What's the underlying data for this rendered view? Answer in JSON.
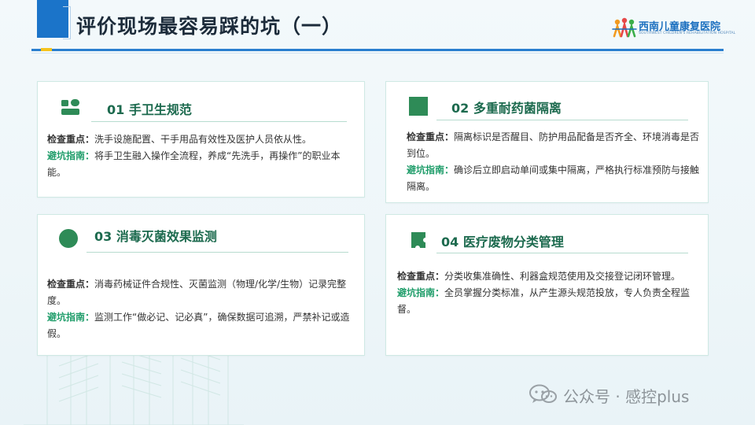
{
  "header": {
    "title": "评价现场最容易踩的坑（一）",
    "logo": {
      "name": "西南儿童康复医院",
      "subtitle": "SOUTHWEST CHILDREN'S REHABILITATION HOSPITAL"
    }
  },
  "labels": {
    "check": "检查重点：",
    "guide": "避坑指南："
  },
  "cards": [
    {
      "title": "01 手卫生规范",
      "icon": "hand-hygiene-icon",
      "check": "洗手设施配置、干手用品有效性及医护人员依从性。",
      "guide": "将手卫生融入操作全流程，养成“先洗手，再操作”的职业本能。"
    },
    {
      "title": "02 多重耐药菌隔离",
      "icon": "square-icon",
      "check": "隔离标识是否醒目、防护用品配备是否齐全、环境消毒是否到位。",
      "guide": "确诊后立即启动单间或集中隔离，严格执行标准预防与接触隔离。"
    },
    {
      "title": "03 消毒灭菌效果监测",
      "icon": "circle-icon",
      "check": "消毒药械证件合规性、灭菌监测（物理/化学/生物）记录完整度。",
      "guide": "监测工作“做必记、记必真”，确保数据可追溯，严禁补记或造假。"
    },
    {
      "title": "04 医疗废物分类管理",
      "icon": "puzzle-icon",
      "check": "分类收集准确性、利器盒规范使用及交接登记闭环管理。",
      "guide": "全员掌握分类标准，从产生源头规范投放，专人负责全程监督。"
    }
  ],
  "watermark": {
    "text": "公众号 · 感控plus"
  },
  "colors": {
    "accent_blue": "#1b74c9",
    "accent_yellow": "#f5c31d",
    "card_green": "#2e8b57",
    "guide_green": "#1f9d6a",
    "title_dark": "#1c2b3a"
  }
}
